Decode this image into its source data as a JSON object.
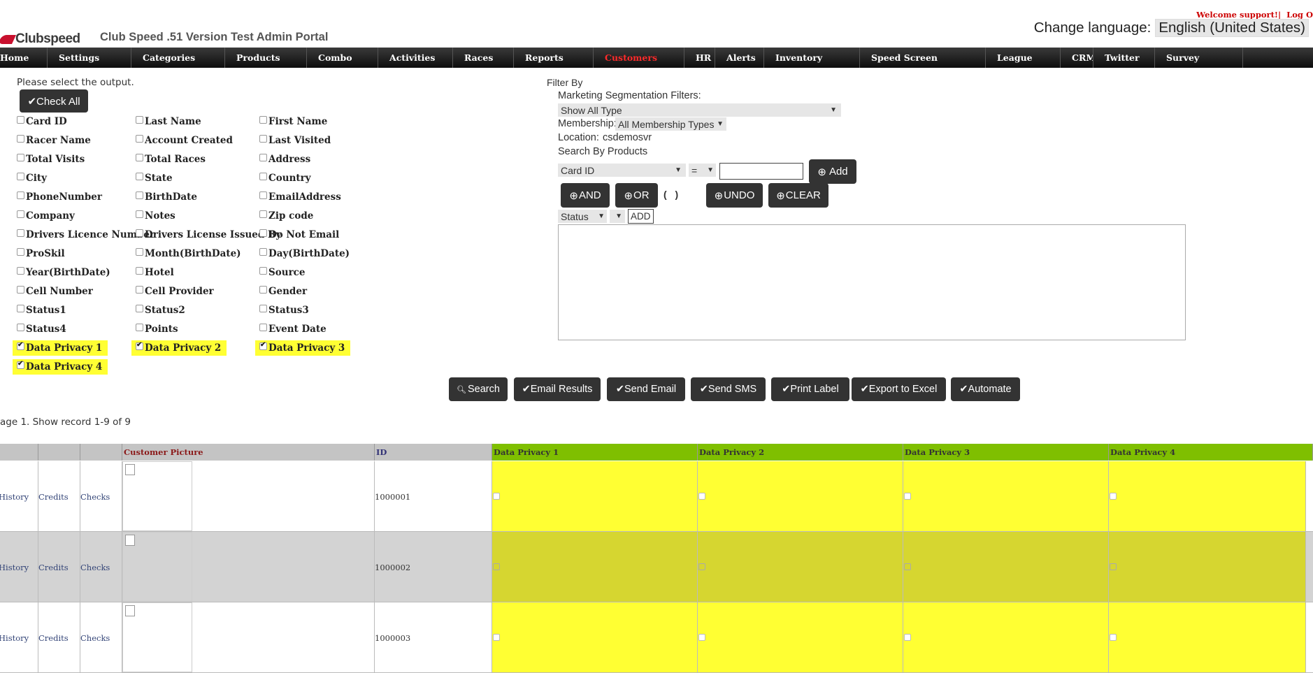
{
  "header": {
    "logo_text": "Clubspeed",
    "portal_title": "Club Speed .51 Version Test Admin Portal",
    "welcome": "Welcome support!|",
    "logout": "Log O",
    "change_language_label": "Change language:",
    "language_value": "English (United States)"
  },
  "nav": {
    "items": [
      {
        "label": "Home",
        "w": 0
      },
      {
        "label": "Settings"
      },
      {
        "label": "Categories"
      },
      {
        "label": "Products"
      },
      {
        "label": "Combo"
      },
      {
        "label": "Activities"
      },
      {
        "label": "Races"
      },
      {
        "label": "Reports"
      },
      {
        "label": "Customers"
      },
      {
        "label": "HR"
      },
      {
        "label": "Alerts"
      },
      {
        "label": "Inventory"
      },
      {
        "label": "Speed Screen"
      },
      {
        "label": "League"
      },
      {
        "label": "CRM"
      },
      {
        "label": "Twitter"
      },
      {
        "label": "Survey"
      }
    ],
    "active": "Customers"
  },
  "output": {
    "prompt": "Please select the output.",
    "check_all": "✔Check All",
    "fields": [
      {
        "label": "Card ID",
        "checked": false
      },
      {
        "label": "Last Name",
        "checked": false
      },
      {
        "label": "First Name",
        "checked": false
      },
      {
        "label": "Racer Name",
        "checked": false
      },
      {
        "label": "Account Created",
        "checked": false
      },
      {
        "label": "Last Visited",
        "checked": false
      },
      {
        "label": "Total Visits",
        "checked": false
      },
      {
        "label": "Total Races",
        "checked": false
      },
      {
        "label": "Address",
        "checked": false
      },
      {
        "label": "City",
        "checked": false
      },
      {
        "label": "State",
        "checked": false
      },
      {
        "label": "Country",
        "checked": false
      },
      {
        "label": "PhoneNumber",
        "checked": false
      },
      {
        "label": "BirthDate",
        "checked": false
      },
      {
        "label": "EmailAddress",
        "checked": false
      },
      {
        "label": "Company",
        "checked": false
      },
      {
        "label": "Notes",
        "checked": false
      },
      {
        "label": "Zip code",
        "checked": false
      },
      {
        "label": "Drivers Licence Number",
        "checked": false
      },
      {
        "label": "Drivers License Issued By",
        "checked": false
      },
      {
        "label": "Do Not Email",
        "checked": false
      },
      {
        "label": "ProSkil",
        "checked": false
      },
      {
        "label": "Month(BirthDate)",
        "checked": false
      },
      {
        "label": "Day(BirthDate)",
        "checked": false
      },
      {
        "label": "Year(BirthDate)",
        "checked": false
      },
      {
        "label": "Hotel",
        "checked": false
      },
      {
        "label": "Source",
        "checked": false
      },
      {
        "label": "Cell Number",
        "checked": false
      },
      {
        "label": "Cell Provider",
        "checked": false
      },
      {
        "label": "Gender",
        "checked": false
      },
      {
        "label": "Status1",
        "checked": false
      },
      {
        "label": "Status2",
        "checked": false
      },
      {
        "label": "Status3",
        "checked": false
      },
      {
        "label": "Status4",
        "checked": false
      },
      {
        "label": "Points",
        "checked": false
      },
      {
        "label": "Event Date",
        "checked": false
      },
      {
        "label": "Data Privacy 1",
        "checked": true
      },
      {
        "label": "Data Privacy 2",
        "checked": true
      },
      {
        "label": "Data Privacy 3",
        "checked": true
      },
      {
        "label": "Data Privacy 4",
        "checked": true
      }
    ]
  },
  "filter": {
    "filter_by": "Filter By",
    "segmentation_label": "Marketing Segmentation Filters:",
    "segmentation_value": "Show All Type",
    "membership_label": "Membership:",
    "membership_value": "All Membership Types",
    "location_label": "Location:",
    "location_value": "csdemosvr",
    "search_by_products": "Search By Products",
    "field_select": "Card ID",
    "operator_select": "=",
    "add_button": "Add",
    "and_button": "AND",
    "or_button": "OR",
    "paren": "( )",
    "undo_button": "UNDO",
    "clear_button": "CLEAR",
    "status_select": "Status",
    "status_add": "ADD"
  },
  "actions": [
    {
      "label": "Search",
      "icon": "search-icon"
    },
    {
      "label": "✔Email Results"
    },
    {
      "label": "✔Send Email"
    },
    {
      "label": "✔Send SMS"
    },
    {
      "label": "✔Print Label"
    },
    {
      "label": "✔Export to Excel"
    },
    {
      "label": "✔Automate"
    }
  ],
  "results": {
    "page_info": "age 1. Show record 1-9 of 9",
    "headers": [
      "Customer Picture",
      "ID",
      "Data Privacy 1",
      "Data Privacy 2",
      "Data Privacy 3",
      "Data Privacy 4"
    ],
    "rows": [
      {
        "history": "History",
        "credits": "Credits",
        "checks": "Checks",
        "id": "1000001"
      },
      {
        "history": "History",
        "credits": "Credits",
        "checks": "Checks",
        "id": "1000002"
      },
      {
        "history": "History",
        "credits": "Credits",
        "checks": "Checks",
        "id": "1000003"
      }
    ]
  },
  "colors": {
    "nav_active": "#ff2a2a",
    "highlight": "#ffff33",
    "header_green": "#7fbf00",
    "button_dark": "#333333"
  }
}
